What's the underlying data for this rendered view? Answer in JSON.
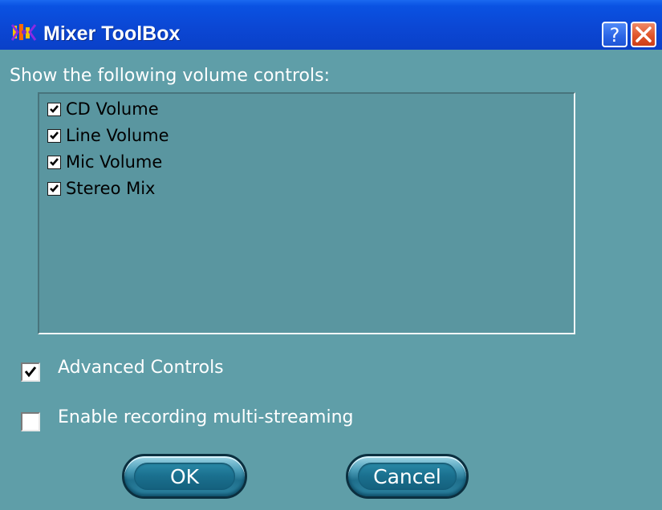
{
  "window": {
    "title": "Mixer ToolBox",
    "help_label": "?",
    "close_label": "×"
  },
  "dialog": {
    "prompt": "Show the following volume controls:",
    "volume_controls": [
      {
        "label": "CD Volume",
        "checked": true
      },
      {
        "label": "Line Volume",
        "checked": true
      },
      {
        "label": "Mic Volume",
        "checked": true
      },
      {
        "label": "Stereo Mix",
        "checked": true
      }
    ],
    "options": [
      {
        "label": "Advanced Controls",
        "checked": true
      },
      {
        "label": "Enable recording multi-streaming",
        "checked": false
      }
    ],
    "buttons": {
      "ok": "OK",
      "cancel": "Cancel"
    }
  },
  "colors": {
    "titlebar": "#0a4fd8",
    "dialog_background": "#5f9ea8",
    "button_face": "#1a6f8e"
  },
  "icons": {
    "app": "mixer-app-icon",
    "help": "help-icon",
    "close": "close-icon",
    "check": "checkmark-icon"
  }
}
